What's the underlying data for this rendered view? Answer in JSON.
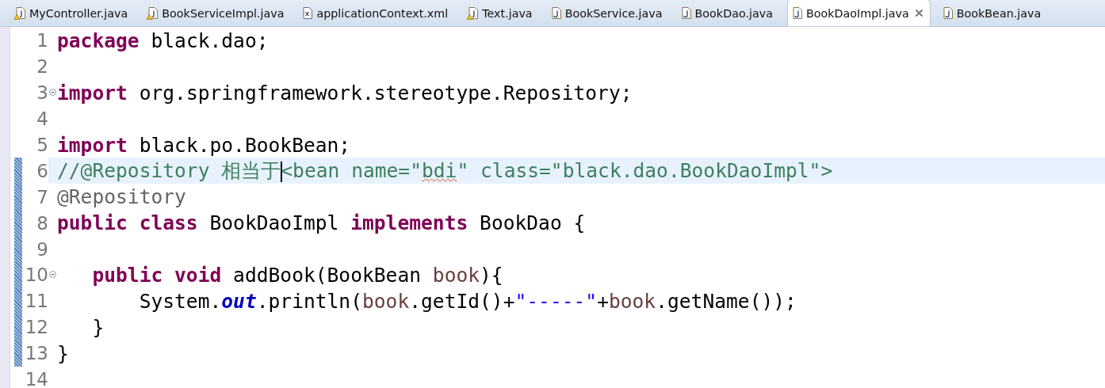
{
  "tabs": [
    {
      "label": "MyController.java",
      "kind": "java-warning",
      "selected": false
    },
    {
      "label": "BookServiceImpl.java",
      "kind": "java-warning",
      "selected": false
    },
    {
      "label": "applicationContext.xml",
      "kind": "xml",
      "selected": false
    },
    {
      "label": "Text.java",
      "kind": "java-warning",
      "selected": false
    },
    {
      "label": "BookService.java",
      "kind": "java",
      "selected": false
    },
    {
      "label": "BookDao.java",
      "kind": "java",
      "selected": false
    },
    {
      "label": "BookDaoImpl.java",
      "kind": "java",
      "selected": true
    },
    {
      "label": "BookBean.java",
      "kind": "java",
      "selected": false
    }
  ],
  "editor": {
    "lines": [
      {
        "number": "1",
        "changed": false,
        "current": false,
        "fold": false,
        "tokens": [
          {
            "kind": "keyword",
            "text": "package"
          },
          {
            "kind": "plain",
            "text": " black.dao;"
          }
        ]
      },
      {
        "number": "2",
        "changed": false,
        "current": false,
        "fold": false
      },
      {
        "number": "3",
        "changed": false,
        "current": false,
        "fold": true,
        "tokens": [
          {
            "kind": "keyword",
            "text": "import"
          },
          {
            "kind": "plain",
            "text": " org.springframework.stereotype.Repository;"
          }
        ]
      },
      {
        "number": "4",
        "changed": false,
        "current": false,
        "fold": false
      },
      {
        "number": "5",
        "changed": false,
        "current": false,
        "fold": false,
        "tokens": [
          {
            "kind": "keyword",
            "text": "import"
          },
          {
            "kind": "plain",
            "text": " black.po.BookBean;"
          }
        ]
      },
      {
        "number": "6",
        "changed": true,
        "current": true,
        "fold": false,
        "tokens": [
          {
            "kind": "comment",
            "text": "//@Repository 相当于"
          },
          {
            "kind": "comment",
            "text": "<bean name=\"",
            "caret_before": true
          },
          {
            "kind": "comment-misspelled",
            "text": "bdi"
          },
          {
            "kind": "comment",
            "text": "\" class=\"black.dao.BookDaoImpl\">"
          }
        ]
      },
      {
        "number": "7",
        "changed": true,
        "current": false,
        "fold": false,
        "tokens": [
          {
            "kind": "annotation",
            "text": "@Repository"
          }
        ]
      },
      {
        "number": "8",
        "changed": true,
        "current": false,
        "fold": false,
        "tokens": [
          {
            "kind": "keyword",
            "text": "public class"
          },
          {
            "kind": "plain",
            "text": " BookDaoImpl "
          },
          {
            "kind": "keyword",
            "text": "implements"
          },
          {
            "kind": "plain",
            "text": " BookDao {"
          }
        ]
      },
      {
        "number": "9",
        "changed": true,
        "current": false,
        "fold": false
      },
      {
        "number": "10",
        "changed": true,
        "current": false,
        "fold": true,
        "tokens": [
          {
            "kind": "keyword",
            "text": "   public void"
          },
          {
            "kind": "plain",
            "text": " addBook(BookBean "
          },
          {
            "kind": "parameter",
            "text": "book"
          },
          {
            "kind": "plain",
            "text": "){"
          }
        ]
      },
      {
        "number": "11",
        "changed": true,
        "current": false,
        "fold": false,
        "tokens": [
          {
            "kind": "plain",
            "text": "       System."
          },
          {
            "kind": "static-field",
            "text": "out"
          },
          {
            "kind": "plain",
            "text": ".println("
          },
          {
            "kind": "parameter",
            "text": "book"
          },
          {
            "kind": "plain",
            "text": ".getId()+"
          },
          {
            "kind": "string",
            "text": "\"-----\""
          },
          {
            "kind": "plain",
            "text": "+"
          },
          {
            "kind": "parameter",
            "text": "book"
          },
          {
            "kind": "plain",
            "text": ".getName());"
          }
        ]
      },
      {
        "number": "12",
        "changed": true,
        "current": false,
        "fold": false,
        "tokens": [
          {
            "kind": "plain",
            "text": "   }"
          }
        ]
      },
      {
        "number": "13",
        "changed": true,
        "current": false,
        "fold": false,
        "tokens": [
          {
            "kind": "plain",
            "text": "}"
          }
        ]
      },
      {
        "number": "14",
        "changed": false,
        "current": false,
        "fold": false
      }
    ]
  }
}
